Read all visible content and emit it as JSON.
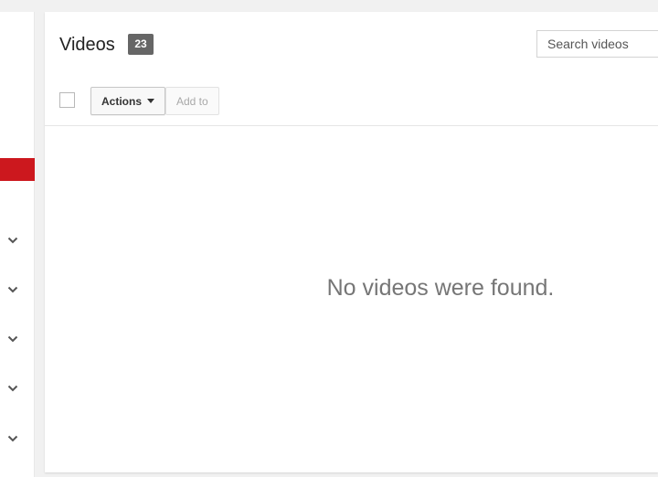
{
  "panel": {
    "title": "Videos",
    "count": "23",
    "search": {
      "placeholder": "Search videos",
      "value": ""
    },
    "toolbar": {
      "actions_label": "Actions",
      "add_to_label": "Add to"
    },
    "empty_message": "No videos were found."
  },
  "sidebar": {
    "active_color": "#cc181e",
    "expand_icon": "chevron-down-icon"
  }
}
